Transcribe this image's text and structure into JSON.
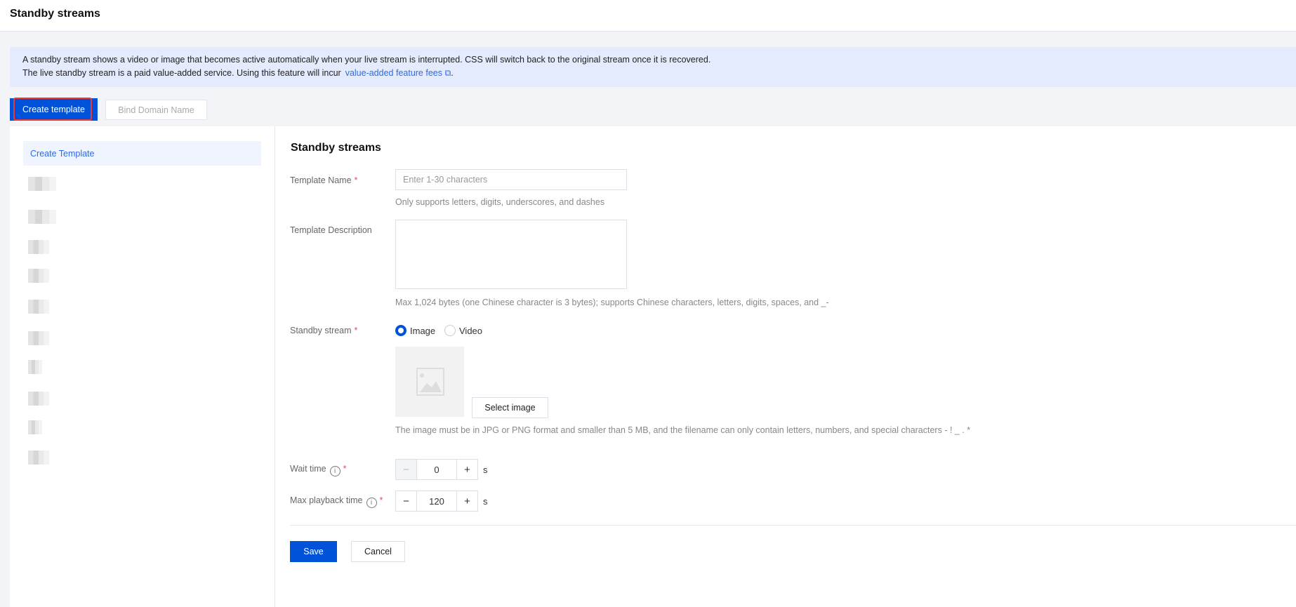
{
  "header": {
    "title": "Standby streams"
  },
  "banner": {
    "line1": "A standby stream shows a video or image that becomes active automatically when your live stream is interrupted. CSS will switch back to the original stream once it is recovered.",
    "line2": "The live standby stream is a paid value-added service. Using this feature will incur",
    "link": "value-added feature fees",
    "link_icon": "external-link-icon",
    "after": "."
  },
  "toolbar": {
    "create": "Create template",
    "bind": "Bind Domain Name"
  },
  "sidebar": {
    "items": [
      {
        "label": "Create Template",
        "selected": true
      }
    ]
  },
  "form": {
    "title": "Standby streams",
    "name": {
      "label": "Template Name",
      "placeholder": "Enter 1-30 characters",
      "value": "",
      "hint": "Only supports letters, digits, underscores, and dashes"
    },
    "desc": {
      "label": "Template Description",
      "value": "",
      "hint": "Max 1,024 bytes (one Chinese character is 3 bytes); supports Chinese characters, letters, digits, spaces, and _-"
    },
    "stream": {
      "label": "Standby stream",
      "options": [
        "Image",
        "Video"
      ],
      "selected": "Image",
      "select_btn": "Select image",
      "hint": "The image must be in JPG or PNG format and smaller than 5 MB, and the filename can only contain letters, numbers, and special characters - ! _ . *"
    },
    "wait": {
      "label": "Wait time",
      "value": "0",
      "unit": "s"
    },
    "max": {
      "label": "Max playback time",
      "value": "120",
      "unit": "s"
    },
    "required_mark": "*",
    "save": "Save",
    "cancel": "Cancel"
  },
  "colors": {
    "primary": "#0052d9",
    "link": "#2f6ae6",
    "banner_bg": "#e3ebfd",
    "highlight": "#e83a3a"
  }
}
